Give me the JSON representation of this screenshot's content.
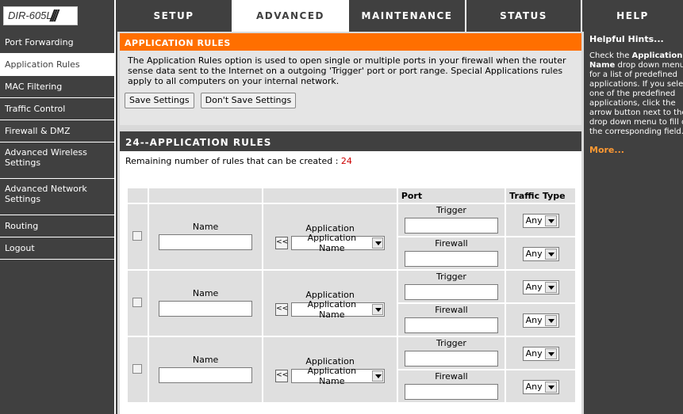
{
  "brand": {
    "model": "DIR-605L",
    "slashes": "///"
  },
  "tabs": [
    {
      "label": "SETUP"
    },
    {
      "label": "ADVANCED"
    },
    {
      "label": "MAINTENANCE"
    },
    {
      "label": "STATUS"
    },
    {
      "label": "HELP"
    }
  ],
  "sidebar": {
    "items": [
      {
        "label": "Port Forwarding"
      },
      {
        "label": "Application Rules"
      },
      {
        "label": "MAC Filtering"
      },
      {
        "label": "Traffic Control"
      },
      {
        "label": "Firewall & DMZ"
      },
      {
        "label": "Advanced Wireless Settings"
      },
      {
        "label": "Advanced Network Settings"
      },
      {
        "label": "Routing"
      },
      {
        "label": "Logout"
      }
    ]
  },
  "app_rules": {
    "title": "APPLICATION RULES",
    "description": "The Application Rules option is used to open single or multiple ports in your firewall when the router sense data sent to the Internet on a outgoing 'Trigger' port or port range. Special Applications rules apply to all computers on your internal network.",
    "save_label": "Save Settings",
    "dont_save_label": "Don't Save Settings"
  },
  "rules_section": {
    "title": "24--APPLICATION RULES",
    "remaining_prefix": "Remaining number of rules that can be created : ",
    "remaining_count": "24",
    "header_port": "Port",
    "header_traffic": "Traffic Type"
  },
  "rule_rows": [
    {
      "name_label": "Name",
      "app_label": "Application",
      "arrow_label": "<<",
      "app_select": "Application Name",
      "trigger_label": "Trigger",
      "firewall_label": "Firewall",
      "trigger_traffic": "Any",
      "firewall_traffic": "Any"
    },
    {
      "name_label": "Name",
      "app_label": "Application",
      "arrow_label": "<<",
      "app_select": "Application Name",
      "trigger_label": "Trigger",
      "firewall_label": "Firewall",
      "trigger_traffic": "Any",
      "firewall_traffic": "Any"
    },
    {
      "name_label": "Name",
      "app_label": "Application",
      "arrow_label": "<<",
      "app_select": "Application Name",
      "trigger_label": "Trigger",
      "firewall_label": "Firewall",
      "trigger_traffic": "Any",
      "firewall_traffic": "Any"
    }
  ],
  "help": {
    "title": "Helpful Hints...",
    "text_before": "Check the ",
    "text_bold": "Application Name",
    "text_after": " drop down menu for a list of predefined applications. If you select one of the predefined applications, click the arrow button next to the drop down menu to fill out the corresponding field.",
    "more": "More..."
  },
  "colors": {
    "header_orange": "#ff6f00",
    "dark_bg": "#404040",
    "remaining_red": "#cc0000",
    "more_link": "#ff9933"
  }
}
